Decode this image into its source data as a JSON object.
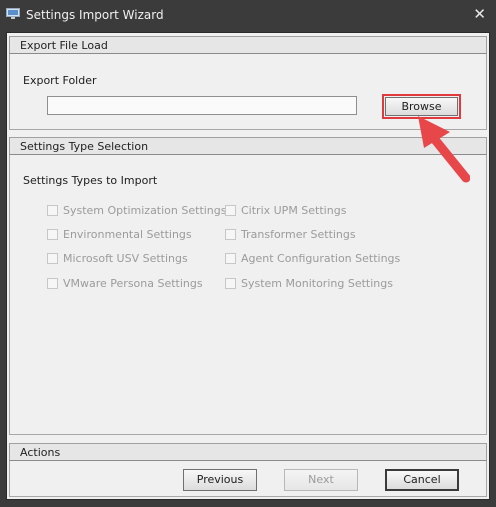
{
  "window": {
    "title": "Settings Import Wizard",
    "close_glyph": "✕",
    "title_icon": "monitor-icon"
  },
  "export_section": {
    "header": "Export File Load",
    "folder_label": "Export Folder",
    "folder_value": "",
    "browse_label": "Browse"
  },
  "types_section": {
    "header": "Settings Type Selection",
    "subheading": "Settings Types to Import",
    "left_column": [
      {
        "label": "System Optimization Settings",
        "checked": false,
        "enabled": false
      },
      {
        "label": "Environmental Settings",
        "checked": false,
        "enabled": false
      },
      {
        "label": "Microsoft USV Settings",
        "checked": false,
        "enabled": false
      },
      {
        "label": "VMware Persona Settings",
        "checked": false,
        "enabled": false
      }
    ],
    "right_column": [
      {
        "label": "Citrix UPM Settings",
        "checked": false,
        "enabled": false
      },
      {
        "label": "Transformer Settings",
        "checked": false,
        "enabled": false
      },
      {
        "label": "Agent Configuration Settings",
        "checked": false,
        "enabled": false
      },
      {
        "label": "System Monitoring Settings",
        "checked": false,
        "enabled": false
      }
    ]
  },
  "actions_section": {
    "header": "Actions",
    "previous_label": "Previous",
    "next_label": "Next",
    "cancel_label": "Cancel"
  },
  "colors": {
    "highlight": "#e0393e",
    "arrow": "#e8474a"
  }
}
